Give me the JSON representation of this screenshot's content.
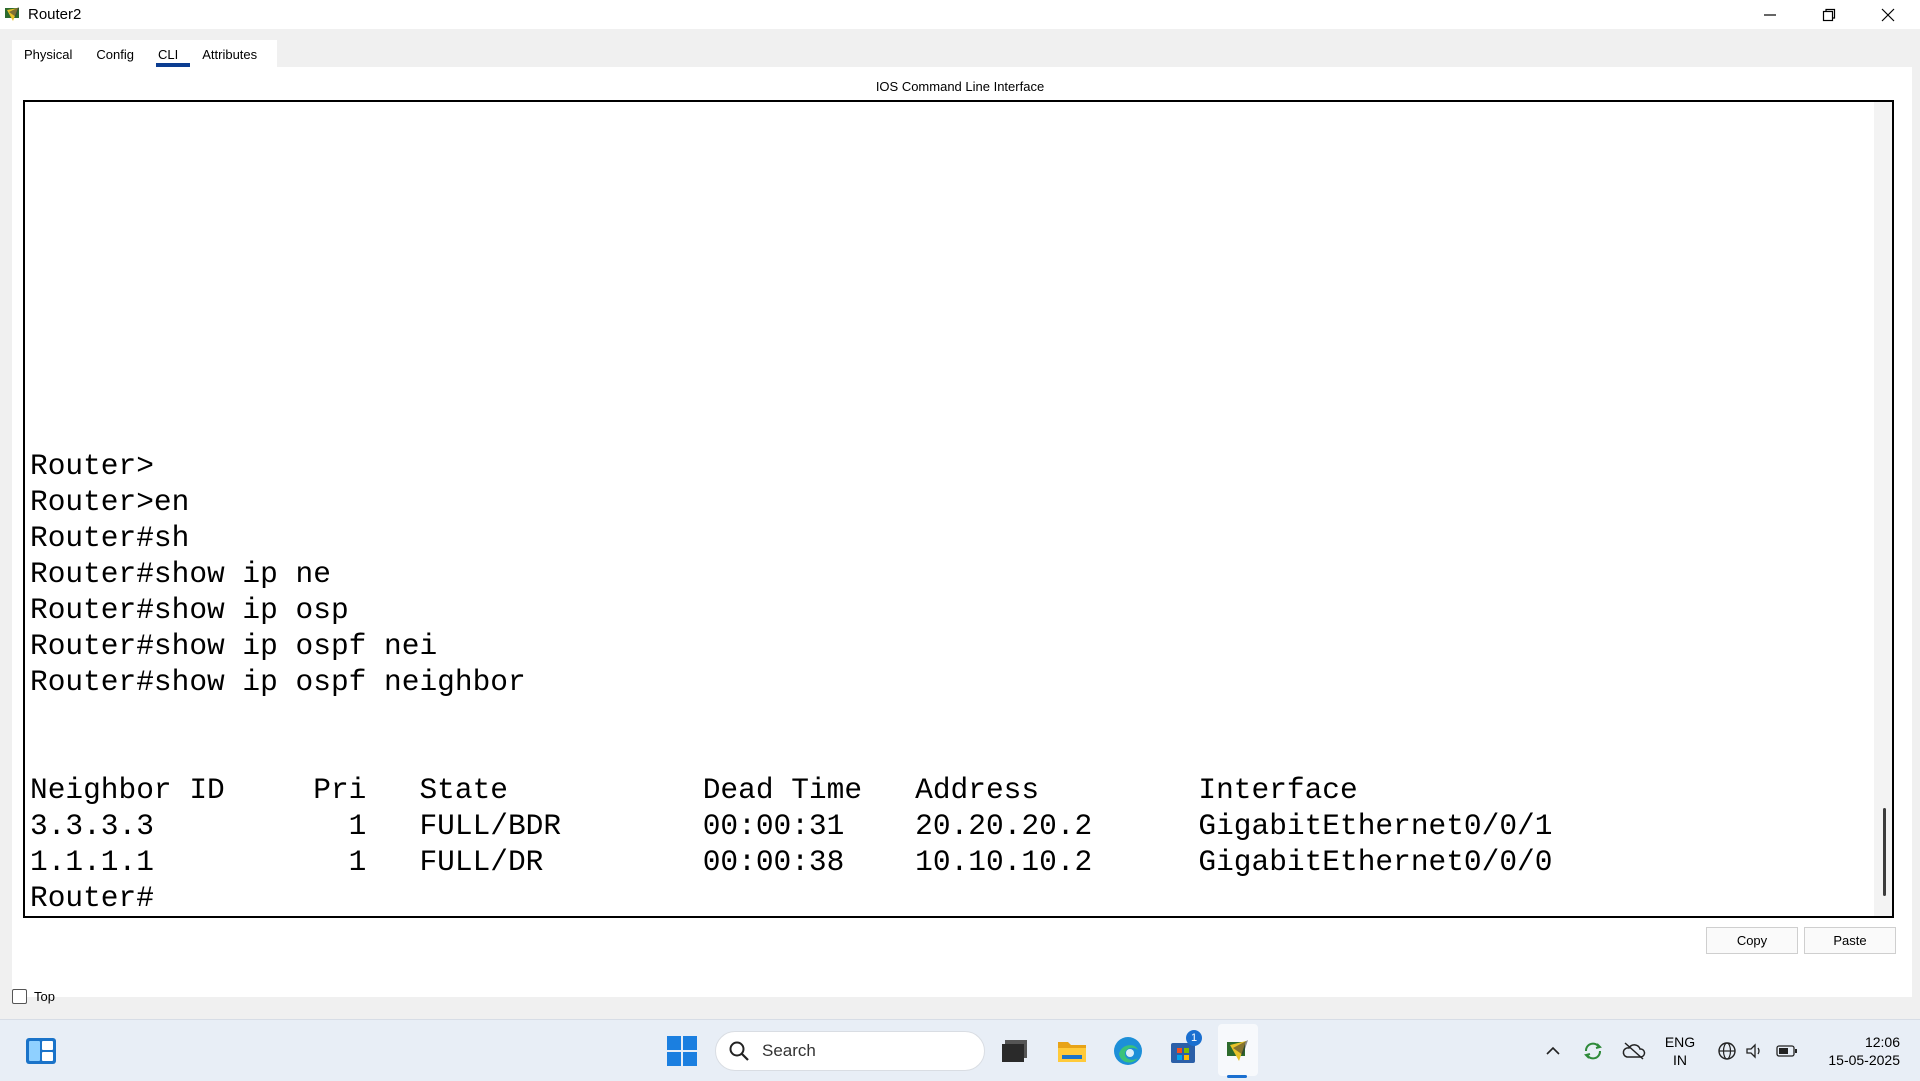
{
  "window": {
    "title": "Router2",
    "controls": [
      "minimize-icon",
      "restore-icon",
      "close-icon"
    ]
  },
  "tabs": [
    {
      "label": "Physical",
      "active": false
    },
    {
      "label": "Config",
      "active": false
    },
    {
      "label": "CLI",
      "active": true
    },
    {
      "label": "Attributes",
      "active": false
    }
  ],
  "cli": {
    "heading": "IOS Command Line Interface",
    "lines": [
      "Router>",
      "Router>en",
      "Router#sh",
      "Router#show ip ne",
      "Router#show ip osp",
      "Router#show ip ospf nei",
      "Router#show ip ospf neighbor",
      "",
      "",
      "Neighbor ID     Pri   State           Dead Time   Address         Interface",
      "3.3.3.3           1   FULL/BDR        00:00:31    20.20.20.2      GigabitEthernet0/0/1",
      "1.1.1.1           1   FULL/DR         00:00:38    10.10.10.2      GigabitEthernet0/0/0",
      "Router#"
    ]
  },
  "buttons": {
    "copy": "Copy",
    "paste": "Paste"
  },
  "top_checkbox": {
    "label": "Top",
    "checked": false
  },
  "taskbar": {
    "search_placeholder": "Search",
    "store_badge": "1",
    "language": {
      "line1": "ENG",
      "line2": "IN"
    },
    "clock": {
      "time": "12:06",
      "date": "15-05-2025"
    },
    "icons": [
      "widgets-icon",
      "start-icon",
      "search-icon",
      "file-explorer-dark-icon",
      "folder-icon",
      "edge-icon",
      "store-icon",
      "packet-tracer-icon",
      "chevron-up-icon",
      "sync-icon",
      "cloud-off-icon",
      "globe-icon",
      "volume-icon",
      "battery-icon"
    ]
  }
}
